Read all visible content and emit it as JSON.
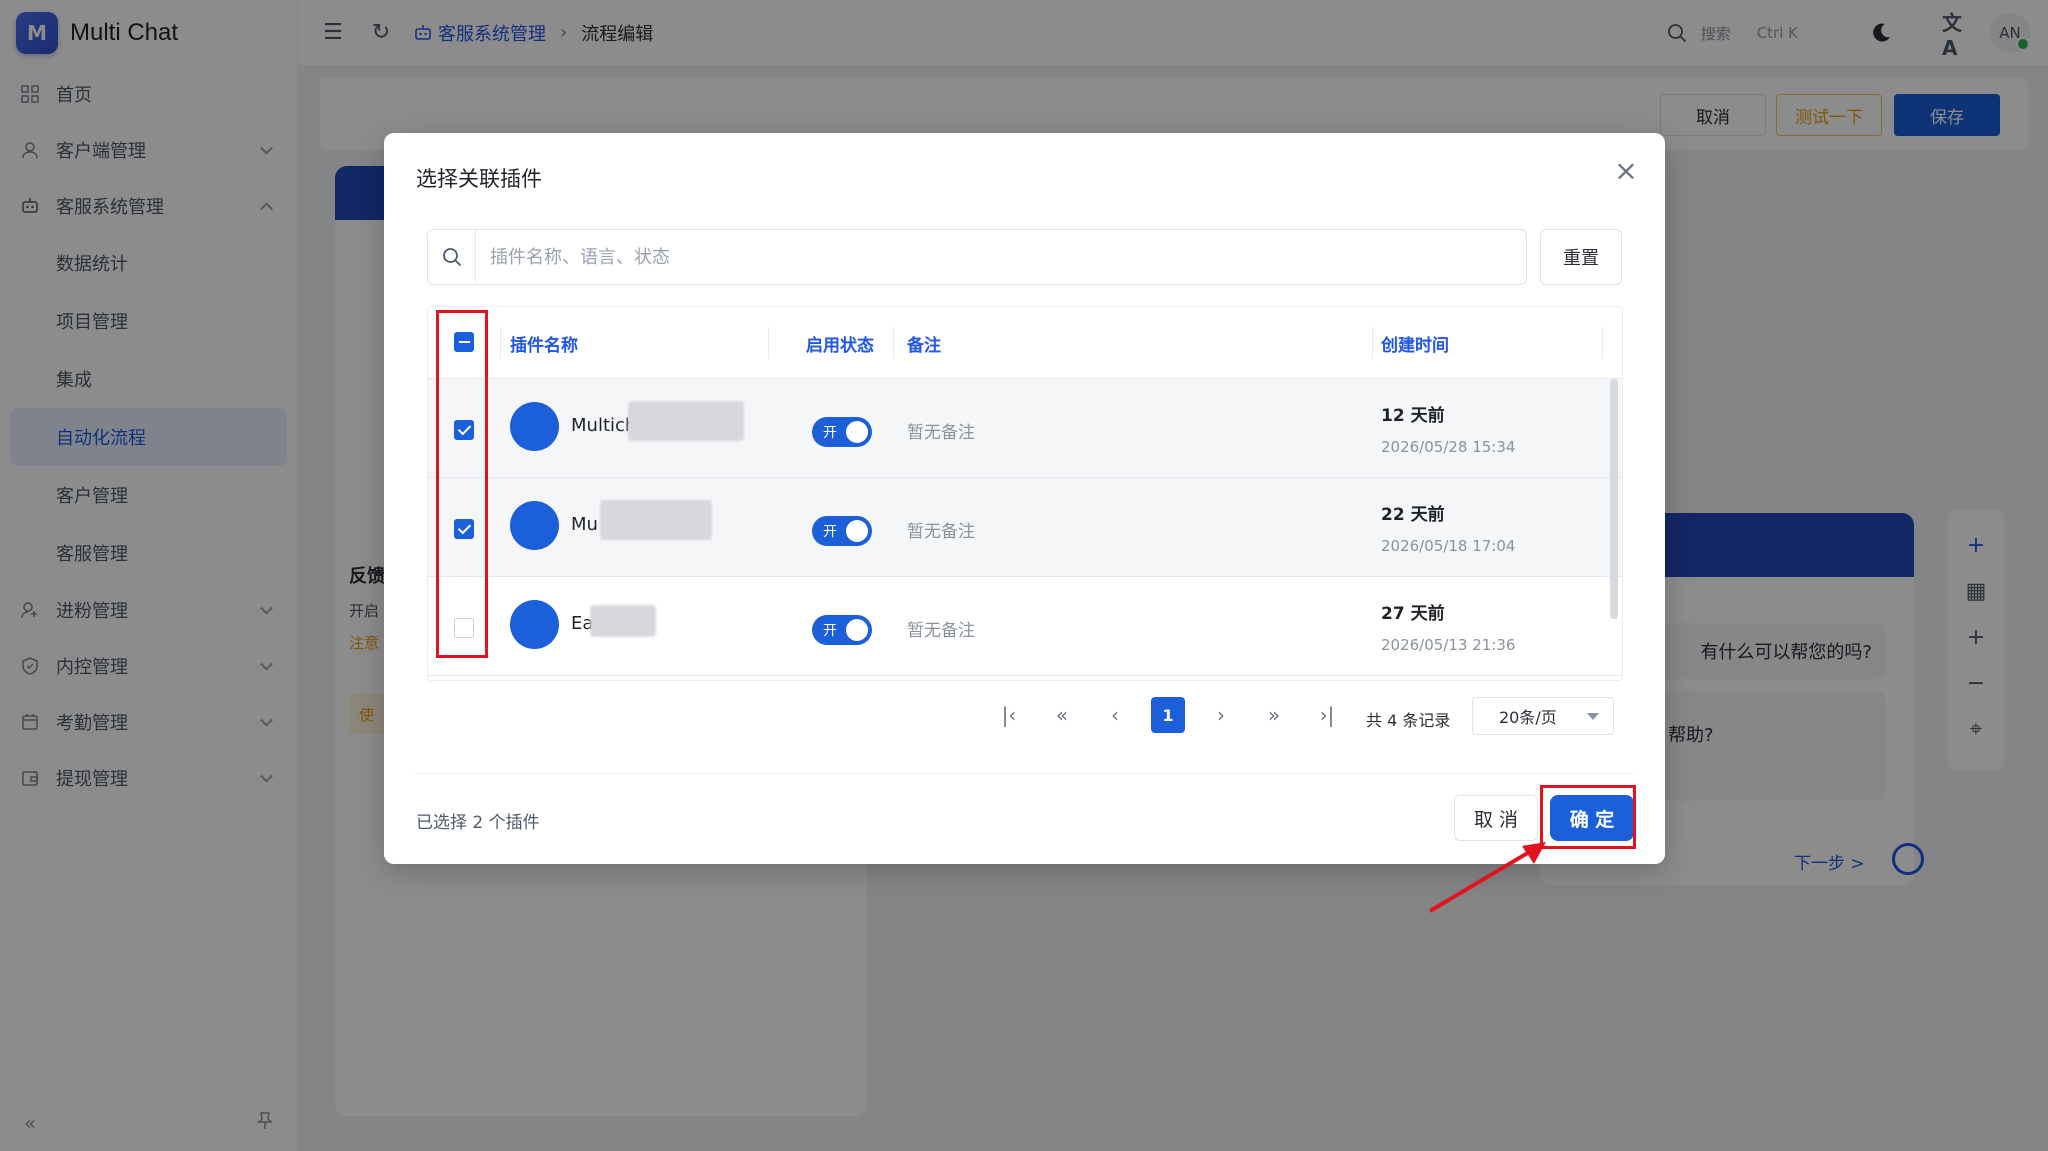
{
  "app": {
    "logo_letter": "M",
    "name": "Multi Chat"
  },
  "sidebar": {
    "items": [
      {
        "label": "首页",
        "icon": "grid-icon",
        "type": "top"
      },
      {
        "label": "客户端管理",
        "icon": "user-icon",
        "type": "group",
        "expanded": false
      },
      {
        "label": "客服系统管理",
        "icon": "robot-icon",
        "type": "group",
        "expanded": true
      },
      {
        "label": "数据统计",
        "type": "sub"
      },
      {
        "label": "项目管理",
        "type": "sub"
      },
      {
        "label": "集成",
        "type": "sub"
      },
      {
        "label": "自动化流程",
        "type": "sub",
        "active": true
      },
      {
        "label": "客户管理",
        "type": "sub"
      },
      {
        "label": "客服管理",
        "type": "sub"
      },
      {
        "label": "进粉管理",
        "icon": "user-add-icon",
        "type": "group",
        "expanded": false
      },
      {
        "label": "内控管理",
        "icon": "shield-icon",
        "type": "group",
        "expanded": false
      },
      {
        "label": "考勤管理",
        "icon": "calendar-icon",
        "type": "group",
        "expanded": false
      },
      {
        "label": "提现管理",
        "icon": "wallet-icon",
        "type": "group",
        "expanded": false
      }
    ]
  },
  "header": {
    "breadcrumb": [
      "客服系统管理",
      "流程编辑"
    ],
    "search_label": "搜索",
    "search_shortcut": "Ctrl K",
    "avatar_initials": "AN"
  },
  "page_toolbar": {
    "cancel": "取消",
    "test": "测试一下",
    "save": "保存"
  },
  "background_text": {
    "left_card": [
      "反馈",
      "开启",
      "注意",
      "使"
    ],
    "right_card": [
      "有什么可以帮您的吗?",
      "帮助?",
      "下一步 >"
    ]
  },
  "modal": {
    "title": "选择关联插件",
    "search_placeholder": "插件名称、语言、状态",
    "reset_label": "重置",
    "columns": {
      "name": "插件名称",
      "status": "启用状态",
      "note": "备注",
      "created": "创建时间"
    },
    "header_checkbox": "indeterminate",
    "rows": [
      {
        "name": "Multich",
        "checked": true,
        "status": "开",
        "note": "暂无备注",
        "created_relative": "12 天前",
        "created_at": "2026/05/28 15:34"
      },
      {
        "name": "Mu",
        "checked": true,
        "status": "开",
        "note": "暂无备注",
        "created_relative": "22 天前",
        "created_at": "2026/05/18 17:04"
      },
      {
        "name": "Ea",
        "checked": false,
        "status": "开",
        "note": "暂无备注",
        "created_relative": "27 天前",
        "created_at": "2026/05/13 21:36"
      }
    ],
    "pagination": {
      "current_page": "1",
      "total_text": "共 4 条记录",
      "page_size": "20条/页"
    },
    "selected_text": "已选择 2 个插件",
    "cancel_label": "取 消",
    "confirm_label": "确 定"
  },
  "colors": {
    "primary": "#1b5fd9",
    "highlight": "#e0141e",
    "brand_blue": "#2348b8"
  }
}
